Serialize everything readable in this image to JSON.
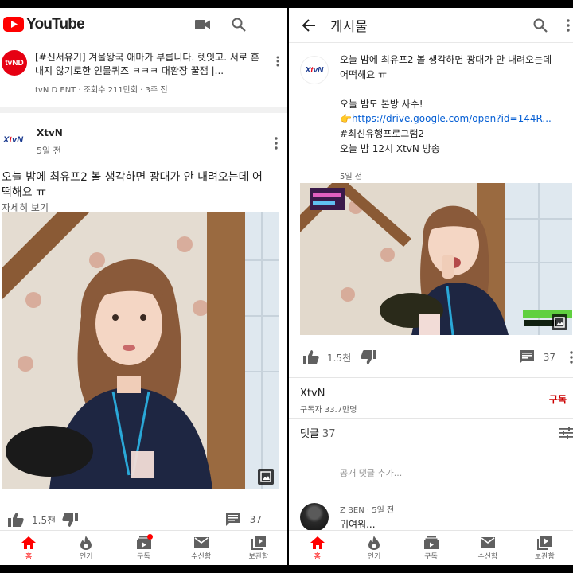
{
  "left": {
    "header": {
      "logo_text": "YouTube"
    },
    "prev_video": {
      "channel_badge": "tvND",
      "title": "[#신서유기] 겨울왕국 애마가 부릅니다. 렛잇고. 서로 혼내지 않기로한 인물퀴즈 ㅋㅋㅋ 대환장 꿀잼 |...",
      "meta": "tvN D ENT · 조회수 211만회 · 3주 전"
    },
    "post": {
      "channel": "XtvN",
      "time": "5일 전",
      "text": "오늘 밤에 최유프2 볼 생각하면 광대가 안 내려오는데 어떡해요 ㅠ",
      "more": "자세히 보기",
      "likes": "1.5천",
      "comments": "37"
    },
    "nav": [
      {
        "label": "홈",
        "active": true
      },
      {
        "label": "인기"
      },
      {
        "label": "구독",
        "dot": true
      },
      {
        "label": "수신함"
      },
      {
        "label": "보관함"
      }
    ]
  },
  "right": {
    "header": {
      "title": "게시물"
    },
    "post": {
      "line1": "오늘 밤에 최유프2 볼 생각하면 광대가 안 내려오는데",
      "line2": "어떡해요 ㅠ",
      "line3": "오늘 밤도 본방 사수!",
      "pointer": "👉",
      "link": "https://drive.google.com/open?id=144R...",
      "hashtag": "#최신유행프로그램2",
      "line5": "오늘 밤 12시 XtvN 방송",
      "time": "5일 전",
      "likes": "1.5천",
      "comments": "37"
    },
    "channel": {
      "name": "XtvN",
      "subs": "구독자 33.7만명",
      "subscribe": "구독"
    },
    "comments_section": {
      "label": "댓글",
      "count": "37",
      "add_placeholder": "공개 댓글 추가...",
      "first": {
        "author": "Z BEN",
        "time": "5일 전",
        "text": "귀여워..."
      }
    },
    "nav": [
      {
        "label": "홈",
        "active": true
      },
      {
        "label": "인기"
      },
      {
        "label": "구독"
      },
      {
        "label": "수신함"
      },
      {
        "label": "보관함"
      }
    ]
  },
  "colors": {
    "accent": "#ff0000",
    "link": "#065fd4",
    "subscribe": "#cc0000"
  }
}
